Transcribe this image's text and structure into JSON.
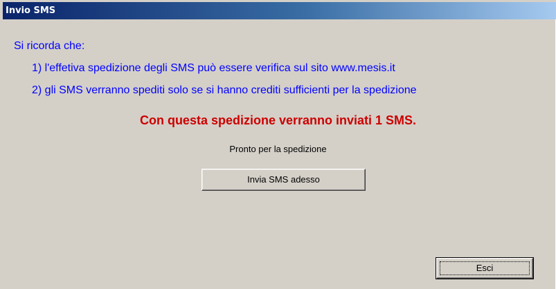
{
  "window": {
    "title": "Invio SMS"
  },
  "reminder": {
    "heading": "Si ricorda che:",
    "items": [
      "1) l'effetiva spedizione degli SMS può essere verifica sul sito www.mesis.it",
      "2) gli SMS verranno spediti solo se si hanno crediti sufficienti per la spedizione"
    ]
  },
  "warning": {
    "text": "Con questa spedizione verranno inviati 1 SMS.",
    "color": "#cc0000"
  },
  "status": {
    "text": "Pronto per la spedizione"
  },
  "buttons": {
    "send_label": "Invia SMS adesso",
    "exit_label": "Esci"
  },
  "colors": {
    "reminder_text": "#0000ff",
    "dialog_background": "#d4d0c8",
    "titlebar_start": "#0a246a"
  }
}
